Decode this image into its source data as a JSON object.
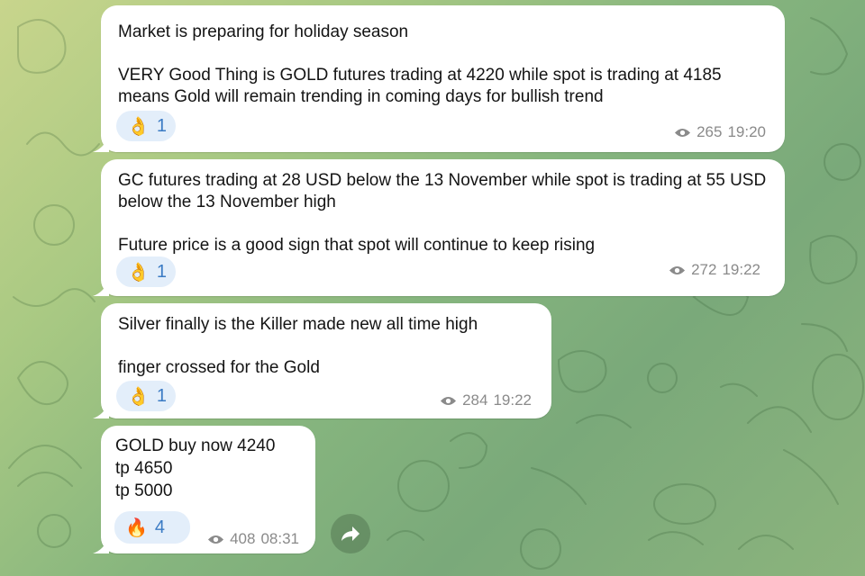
{
  "theme": {
    "bubble_color": "#ffffff",
    "reaction_bg": "#e3eefa",
    "reaction_count_color": "#3b7bc4",
    "meta_color": "#8a8a8a"
  },
  "messages": [
    {
      "text": "Market is preparing for holiday season\n\nVERY Good Thing is GOLD futures trading at 4220 while spot is trading at 4185 means Gold will remain trending in coming days for bullish trend",
      "reaction": {
        "emoji": "👌",
        "icon": "ok-hand-emoji",
        "count": "1"
      },
      "views": "265",
      "time": "19:20"
    },
    {
      "text": "GC futures trading at 28 USD below the 13 November while spot is trading at 55 USD below the 13 November high\n\nFuture price is a good sign that spot will continue to keep rising",
      "reaction": {
        "emoji": "👌",
        "icon": "ok-hand-emoji",
        "count": "1"
      },
      "views": "272",
      "time": "19:22"
    },
    {
      "text": "Silver finally is the Killer made new all time high\n\nfinger crossed for the Gold",
      "reaction": {
        "emoji": "👌",
        "icon": "ok-hand-emoji",
        "count": "1"
      },
      "views": "284",
      "time": "19:22"
    },
    {
      "text": "GOLD buy now 4240\ntp 4650\ntp 5000",
      "reaction": {
        "emoji": "🔥",
        "icon": "fire-emoji",
        "count": "4"
      },
      "views": "408",
      "time": "08:31"
    }
  ],
  "share_button": {
    "icon": "share-arrow-icon"
  }
}
